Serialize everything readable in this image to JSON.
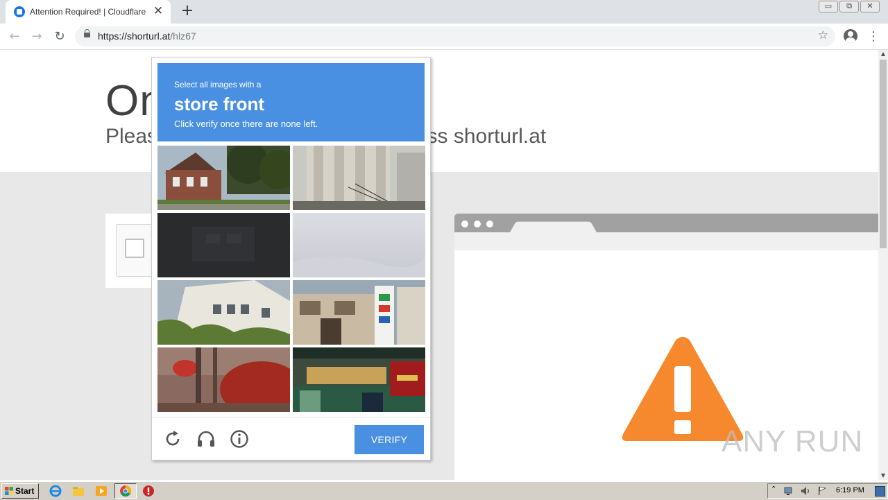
{
  "browser": {
    "tab_title": "Attention Required! | Cloudflare",
    "tab_close": "✕",
    "new_tab": "+",
    "url_host": "https://shorturl.at",
    "url_path": "/hlz67",
    "back": "←",
    "forward": "→",
    "reload": "↻",
    "bookmark": "☆",
    "menu": "⋮",
    "window_controls": [
      "▭",
      "⧉",
      "✕"
    ]
  },
  "page": {
    "hero_title": "On",
    "hero_subtitle": "Pleas                                   to access shorturl.at",
    "watermark": "ANY  RUN"
  },
  "challenge": {
    "prompt_line1": "Select all images with a",
    "prompt_target": "store front",
    "prompt_line3": "Click verify once there are none left.",
    "verify_label": "VERIFY",
    "accent_color": "#4a90e2",
    "tiles": [
      "house",
      "tower",
      "dark",
      "sky",
      "building",
      "japanese-storefront",
      "blur-red",
      "shop-sign"
    ],
    "footer_icons": [
      "reload-icon",
      "audio-icon",
      "info-icon"
    ]
  },
  "taskbar": {
    "start_label": "Start",
    "clock": "6:19 PM"
  },
  "colors": {
    "warning": "#f6892e",
    "browser_tabstrip": "#dee1e6"
  }
}
